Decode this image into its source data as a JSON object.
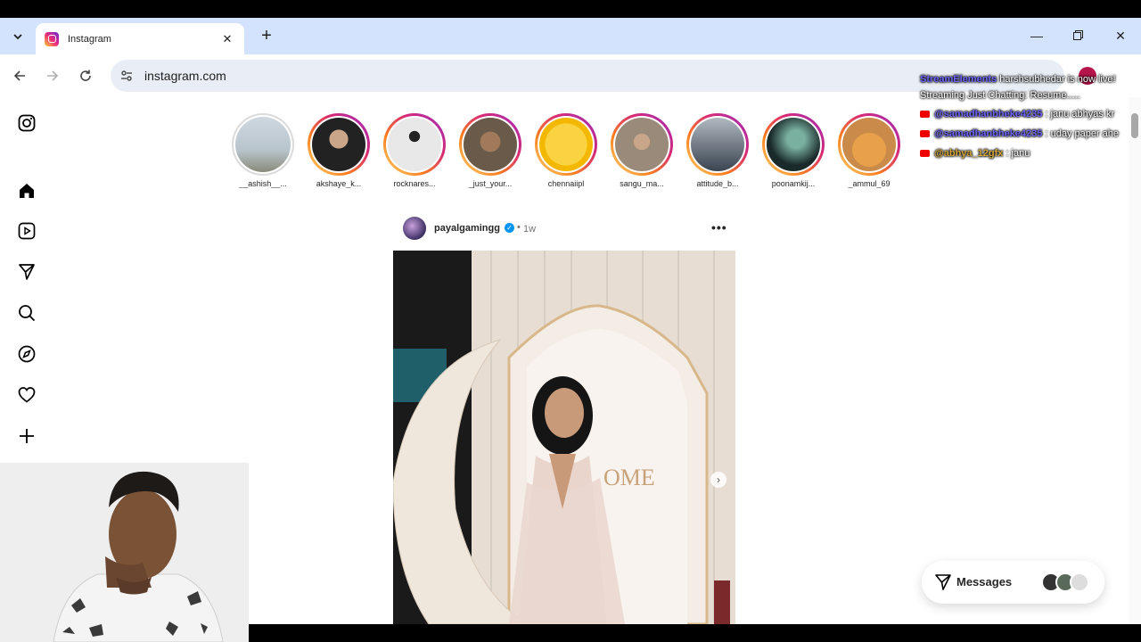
{
  "browser": {
    "tab_title": "Instagram",
    "url": "instagram.com"
  },
  "stories": [
    {
      "username": "__ashish__...",
      "seen": true,
      "color": "#8a9aa8"
    },
    {
      "username": "akshaye_k...",
      "seen": false,
      "color": "#5a5a5a"
    },
    {
      "username": "rocknares...",
      "seen": false,
      "color": "#9a9a9a"
    },
    {
      "username": "_just_your...",
      "seen": false,
      "color": "#7a6a5a"
    },
    {
      "username": "chennaiipl",
      "seen": false,
      "color": "#f5c518"
    },
    {
      "username": "sangu_ma...",
      "seen": false,
      "color": "#8a7a6a"
    },
    {
      "username": "attitude_b...",
      "seen": false,
      "color": "#5a6a7a"
    },
    {
      "username": "poonamkij...",
      "seen": false,
      "color": "#2a3a3a"
    },
    {
      "username": "_ammul_69",
      "seen": false,
      "color": "#e8a04a"
    }
  ],
  "post": {
    "username": "payalgamingg",
    "time": "1w",
    "image_text": "OME"
  },
  "messages": {
    "label": "Messages"
  },
  "chat": [
    {
      "user": "StreamElements",
      "text": "harshsubhedar is now live! Streaming Just Chatting: Resume.....",
      "source": "twitch"
    },
    {
      "user": "@samadhanbheke4235",
      "text": ": janu abhyas kr",
      "source": "youtube"
    },
    {
      "user": "@samadhanbheke4235",
      "text": ": uday paper ahe",
      "source": "youtube"
    },
    {
      "user": "@abhya_12gfx",
      "text": ": janu",
      "source": "youtube"
    }
  ],
  "colors": {
    "tabbar": "#d3e3fd",
    "instagram_gradient": [
      "#feda75",
      "#fa7e1e",
      "#d62976",
      "#962fbf"
    ],
    "verified": "#0095f6"
  }
}
